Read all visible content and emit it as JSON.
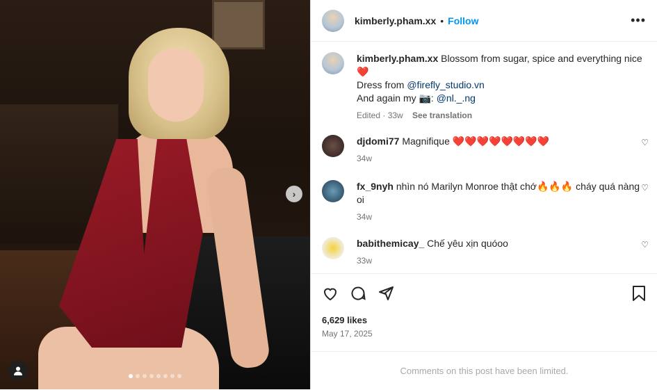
{
  "post": {
    "username": "kimberly.pham.xx",
    "follow_label": "Follow",
    "separator": "•",
    "more_icon": "more-horizontal-icon",
    "caption": {
      "text": "Blossom from sugar, spice and everything nice",
      "emoji": "❤️",
      "line2_prefix": "Dress from ",
      "line2_mention": "@firefly_studio.vn",
      "line3_prefix": "And again my 📷: ",
      "line3_mention": "@nl._.ng",
      "edited": "Edited · 33w",
      "see_translation": "See translation"
    },
    "comments": [
      {
        "username": "djdomi77",
        "text": "Magnifique ❤️❤️❤️❤️❤️❤️❤️❤️",
        "age": "34w"
      },
      {
        "username": "fx_9nyh",
        "text": "nhìn nó Marilyn Monroe thật chớ🔥🔥🔥 cháy quá nàng oi",
        "age": "34w"
      },
      {
        "username": "babithemicay_",
        "text": "Chế yêu xịn quóoo",
        "age": "33w"
      }
    ],
    "likes": "6,629 likes",
    "date": "May 17, 2025",
    "comments_limited": "Comments on this post have been limited.",
    "carousel": {
      "count": 8,
      "active_index": 0
    }
  },
  "colors": {
    "accent": "#0095f6",
    "link": "#00376b",
    "muted": "#737373"
  }
}
